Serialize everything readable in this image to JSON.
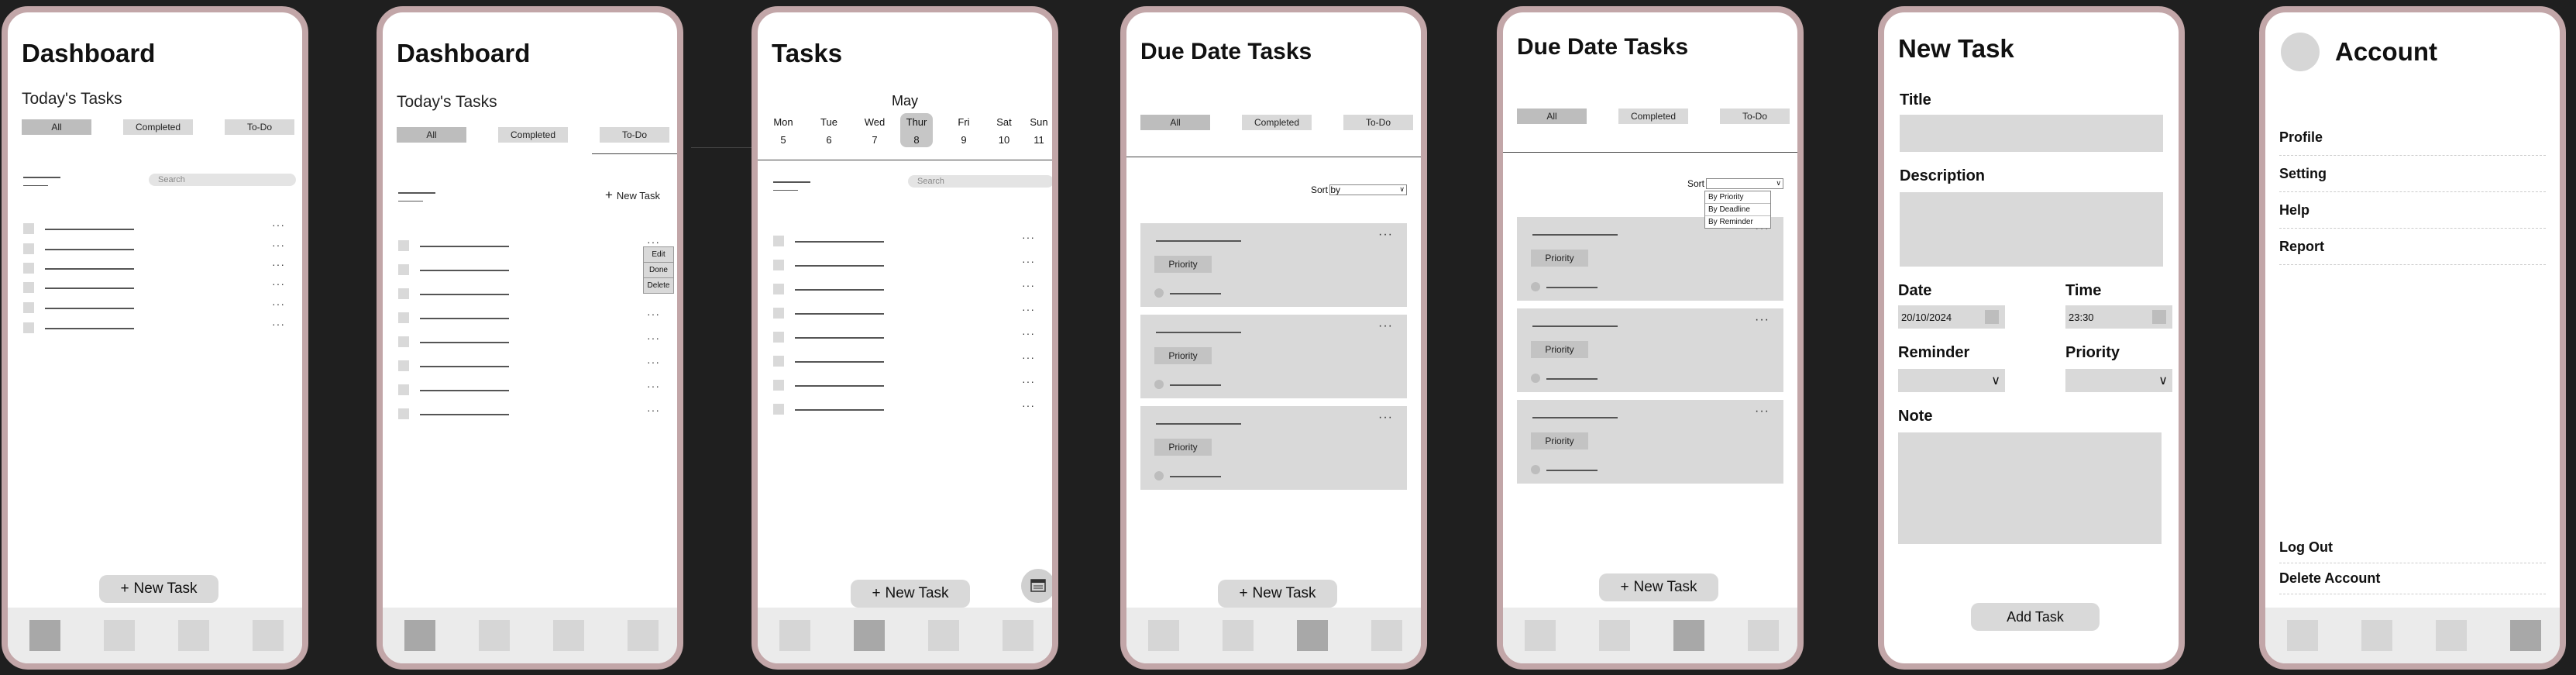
{
  "screens": {
    "dashboard": {
      "title": "Dashboard",
      "subtitle": "Today's Tasks",
      "chips": [
        "All",
        "Completed",
        "To-Do"
      ],
      "search_placeholder": "Search",
      "new_task": "New Task"
    },
    "dashboard_menu": {
      "title": "Dashboard",
      "subtitle": "Today's Tasks",
      "chips": [
        "All",
        "Completed",
        "To-Do"
      ],
      "new_task_link": "New Task",
      "context_menu": [
        "Edit",
        "Done",
        "Delete"
      ]
    },
    "tasks": {
      "title": "Tasks",
      "month": "May",
      "days": [
        {
          "name": "Mon",
          "num": "5"
        },
        {
          "name": "Tue",
          "num": "6"
        },
        {
          "name": "Wed",
          "num": "7"
        },
        {
          "name": "Thur",
          "num": "8"
        },
        {
          "name": "Fri",
          "num": "9"
        },
        {
          "name": "Sat",
          "num": "10"
        },
        {
          "name": "Sun",
          "num": "11"
        }
      ],
      "search_placeholder": "Search",
      "new_task": "New Task"
    },
    "due_date": {
      "title": "Due Date Tasks",
      "chips": [
        "All",
        "Completed",
        "To-Do"
      ],
      "sort_label": "Sort by",
      "card_badge": "Priority",
      "new_task": "New Task"
    },
    "due_date_sort": {
      "title": "Due Date Tasks",
      "chips": [
        "All",
        "Completed",
        "To-Do"
      ],
      "sort_label": "Sort by",
      "sort_options": [
        "By Priority",
        "By Deadline",
        "By Reminder"
      ],
      "card_badge": "Priority",
      "new_task": "New Task"
    },
    "new_task": {
      "title": "New Task",
      "title_label": "Title",
      "description_label": "Description",
      "date_label": "Date",
      "date_value": "20/10/2024",
      "time_label": "Time",
      "time_value": "23:30",
      "reminder_label": "Reminder",
      "priority_label": "Priority",
      "note_label": "Note",
      "add_button": "Add Task"
    },
    "account": {
      "title": "Account",
      "menu": [
        "Profile",
        "Setting",
        "Help",
        "Report"
      ],
      "bottom": [
        "Log Out",
        "Delete Account"
      ]
    }
  },
  "glyphs": {
    "plus": "+",
    "dots": "···",
    "chevron": "∨"
  }
}
